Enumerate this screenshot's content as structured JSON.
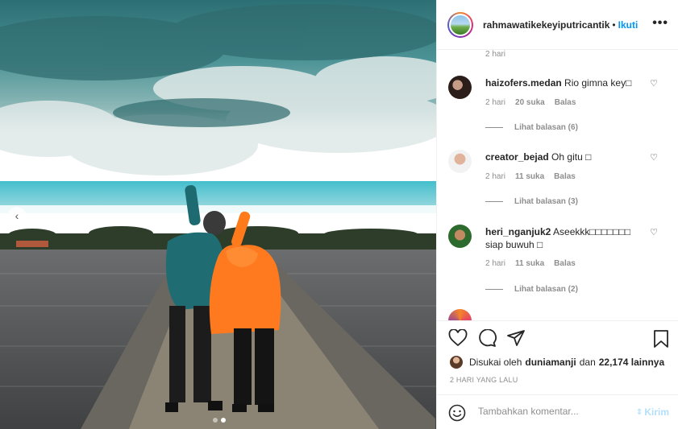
{
  "post": {
    "username": "rahmawatikekeyiputricantik",
    "separator": "•",
    "follow_label": "Ikuti",
    "more_label": "•••",
    "prev_label": "‹"
  },
  "comments": {
    "top_time": "2 hari",
    "items": [
      {
        "username": "haizofers.medan",
        "text": "Rio gimna key□",
        "time": "2 hari",
        "likes": "20 suka",
        "reply": "Balas",
        "replies": "Lihat balasan (6)"
      },
      {
        "username": "creator_bejad",
        "text": "Oh gitu □",
        "time": "2 hari",
        "likes": "11 suka",
        "reply": "Balas",
        "replies": "Lihat balasan (3)"
      },
      {
        "username": "heri_nganjuk2",
        "text": "Aseekkk□□□□□□□ siap buwuh □",
        "time": "2 hari",
        "likes": "11 suka",
        "reply": "Balas",
        "replies": "Lihat balasan (2)"
      }
    ]
  },
  "likes_line": {
    "prefix": "Disukai oleh",
    "liker": "duniamanji",
    "conj": "dan",
    "others": "22,174 lainnya"
  },
  "date": "2 HARI YANG LALU",
  "add_comment": {
    "placeholder": "Tambahkan komentar...",
    "send_label": "Kirim"
  },
  "colors": {
    "accent": "#0095f6",
    "send_disabled": "#b2dffc",
    "muted": "#8e8e8e"
  },
  "icons": [
    "heart-icon",
    "comment-icon",
    "share-icon",
    "bookmark-icon",
    "emoji-icon",
    "more-icon",
    "chevron-left-icon"
  ],
  "carousel": {
    "count": 2,
    "active": 2
  }
}
